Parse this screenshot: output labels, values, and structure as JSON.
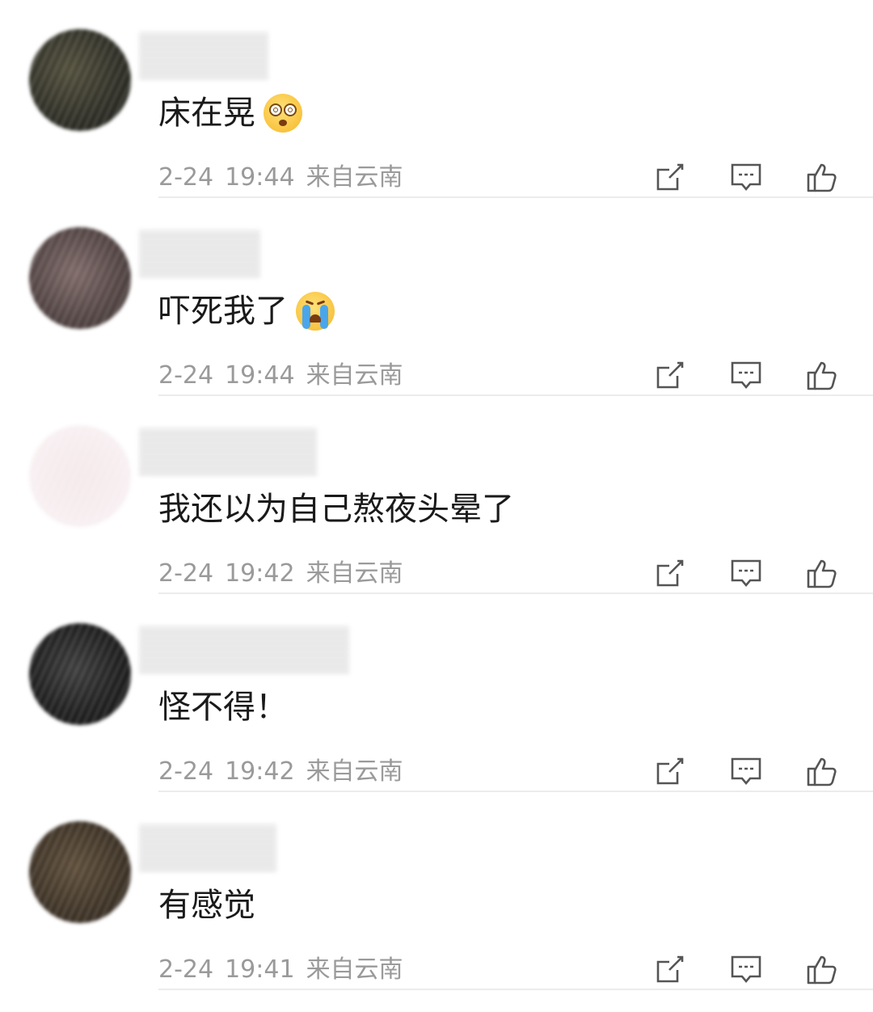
{
  "comments": [
    {
      "text": "床在晃",
      "emoji": "dizzy-face",
      "date": "2-24",
      "time": "19:44",
      "location": "来自云南",
      "avatar_color": "#3b3a2c"
    },
    {
      "text": "吓死我了",
      "emoji": "crying-face",
      "date": "2-24",
      "time": "19:44",
      "location": "来自云南",
      "avatar_color": "#5a4a48"
    },
    {
      "text": "我还以为自己熬夜头晕了",
      "emoji": "",
      "date": "2-24",
      "time": "19:42",
      "location": "来自云南",
      "avatar_color": "#f2e6e8"
    },
    {
      "text": "怪不得！",
      "emoji": "",
      "date": "2-24",
      "time": "19:42",
      "location": "来自云南",
      "avatar_color": "#1f1f1f"
    },
    {
      "text": "有感觉",
      "emoji": "",
      "date": "2-24",
      "time": "19:41",
      "location": "来自云南",
      "avatar_color": "#3f3326"
    }
  ],
  "icons": {
    "share": "share-icon",
    "comment": "comment-icon",
    "like": "like-icon"
  },
  "colors": {
    "meta_text": "#9a9a9a",
    "divider": "#ececec",
    "icon_stroke": "#555555"
  }
}
